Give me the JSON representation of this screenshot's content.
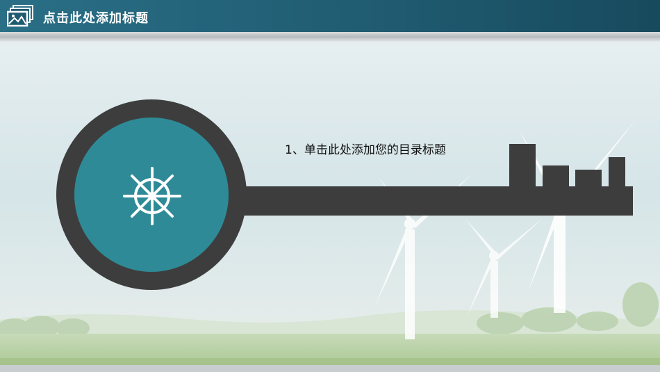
{
  "header": {
    "title": "点击此处添加标题",
    "logo_icon": "picture-frame-icon",
    "colors": {
      "header_bg": "#1f5a70",
      "title": "#ffffff"
    }
  },
  "toc": {
    "item_text": "1、单击此处添加您的目录标题"
  },
  "key_graphic": {
    "icon": "ship-wheel-icon",
    "colors": {
      "ring": "#3d3d3d",
      "disc": "#2e8a96",
      "bar": "#3d3d3d",
      "icon": "#ffffff"
    }
  },
  "background": {
    "scene": "wind-turbines-icon",
    "colors": {
      "sky_top": "#cfe1e5",
      "grass": "#a9c890"
    }
  }
}
